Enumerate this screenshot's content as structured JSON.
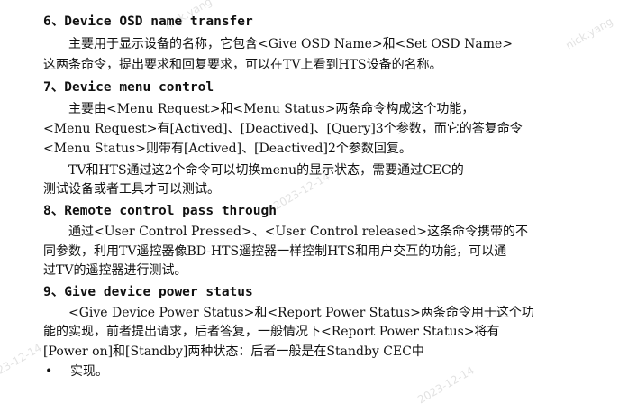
{
  "watermarks": {
    "name": "nick.yang",
    "date": "2023-12-14"
  },
  "section6": {
    "heading": "6、Device OSD name transfer",
    "line1": "主要用于显示设备的名称，它包含<Give  OSD Name>和<Set OSD Name>",
    "line2": "这两条命令，提出要求和回复要求，可以在TV上看到HTS设备的名称。"
  },
  "section7": {
    "heading": "7、Device menu control",
    "line1": "主要由<Menu Request>和<Menu Status>两条命令构成这个功能，",
    "line2": "<Menu Request>有[Actived]、[Deactived]、[Query]3个参数，而它的答复命令",
    "line3": "<Menu Status>则带有[Actived]、[Deactived]2个参数回复。",
    "line4": "TV和HTS通过这2个命令可以切换menu的显示状态，需要通过CEC的",
    "line5": "测试设备或者工具才可以测试。"
  },
  "section8": {
    "heading": "8、Remote control pass through",
    "line1": "通过<User Control Pressed>、<User Control released>这条命令携带的不",
    "line2": "同参数，利用TV遥控器像BD-HTS遥控器一样控制HTS和用户交互的功能，可以通",
    "line3": "过TV的遥控器进行测试。"
  },
  "section9": {
    "heading": "9、Give device power status",
    "line1": "<Give Device Power Status>和<Report Power Status>两条命令用于这个功",
    "line2": "能的实现，前者提出请求，后者答复，一般情况下<Report Power Status>将有",
    "line3": "[Power on]和[Standby]两种状态：后者一般是在Standby CEC中",
    "bullet": "•",
    "line4": "实现。"
  }
}
